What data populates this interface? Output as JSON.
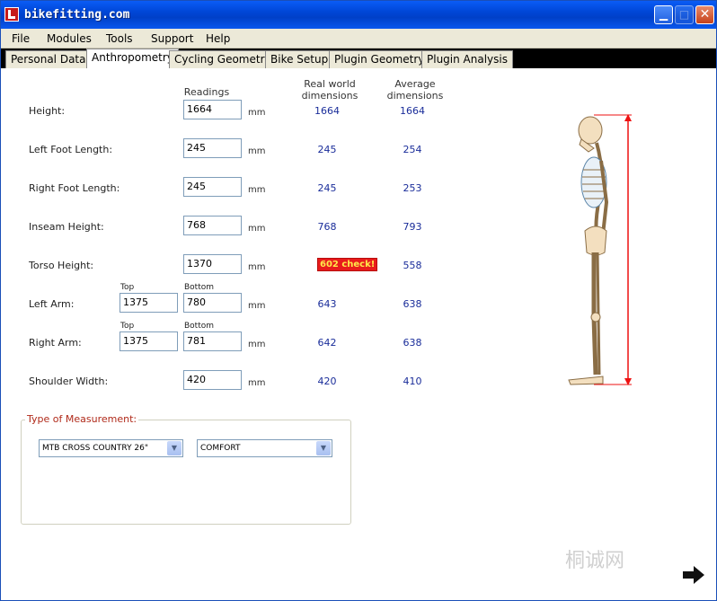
{
  "window": {
    "title": "bikefitting.com"
  },
  "menu": [
    "File",
    "Modules",
    "Tools",
    "Support",
    "Help"
  ],
  "tabs": [
    "Personal Data",
    "Anthropometry",
    "Cycling Geometry",
    "Bike Setup",
    "Plugin Geometry",
    "Plugin Analysis"
  ],
  "columns": {
    "readings": "Readings",
    "real_world_1": "Real world",
    "real_world_2": "dimensions",
    "average_1": "Average",
    "average_2": "dimensions"
  },
  "unit": "mm",
  "sub_labels": {
    "top": "Top",
    "bottom": "Bottom"
  },
  "rows": [
    {
      "label": "Height:",
      "reading": "1664",
      "real": "1664",
      "average": "1664"
    },
    {
      "label": "Left Foot Length:",
      "reading": "245",
      "real": "245",
      "average": "254"
    },
    {
      "label": "Right Foot Length:",
      "reading": "245",
      "real": "245",
      "average": "253"
    },
    {
      "label": "Inseam Height:",
      "reading": "768",
      "real": "768",
      "average": "793"
    },
    {
      "label": "Torso Height:",
      "reading": "1370",
      "real": "602 check!",
      "average": "558"
    },
    {
      "label": "Left Arm:",
      "top": "1375",
      "bottom": "780",
      "real": "643",
      "average": "638"
    },
    {
      "label": "Right Arm:",
      "top": "1375",
      "bottom": "781",
      "real": "642",
      "average": "638"
    },
    {
      "label": "Shoulder Width:",
      "reading": "420",
      "real": "420",
      "average": "410"
    }
  ],
  "measurement": {
    "legend": "Type of Measurement:",
    "bike_type": "MTB CROSS COUNTRY 26\"",
    "fit_type": "COMFORT"
  },
  "watermark": "桐诚网",
  "colors": {
    "title_bar": "#0046d6",
    "warning_bg": "#e81c1c",
    "warning_text": "#ffe94a",
    "value_text": "#1a2d9a",
    "legend_text": "#b02a1a"
  }
}
